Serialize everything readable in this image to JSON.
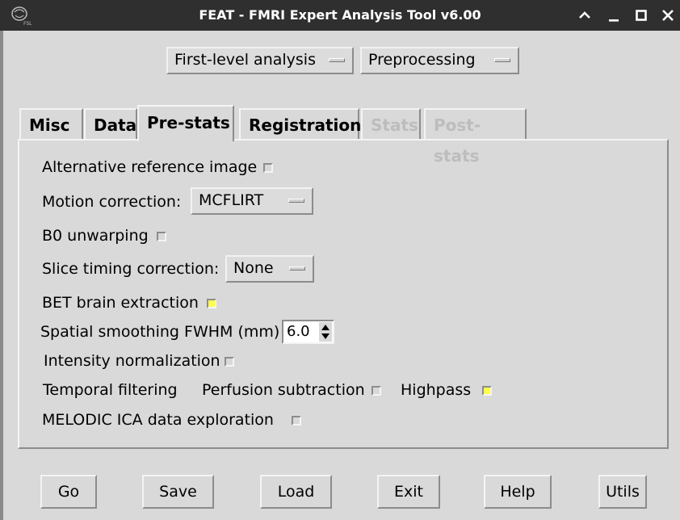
{
  "window": {
    "title": "FEAT - FMRI Expert Analysis Tool v6.00"
  },
  "top_selects": {
    "analysis_level": "First-level analysis",
    "analysis_stage": "Preprocessing"
  },
  "tabs": [
    {
      "label": "Misc",
      "state": "inactive"
    },
    {
      "label": "Data",
      "state": "inactive"
    },
    {
      "label": "Pre-stats",
      "state": "active"
    },
    {
      "label": "Registration",
      "state": "inactive"
    },
    {
      "label": "Stats",
      "state": "disabled"
    },
    {
      "label": "Post-stats",
      "state": "disabled"
    }
  ],
  "prestats": {
    "alt_reference": {
      "label": "Alternative reference image",
      "checked": false
    },
    "motion_correction": {
      "label": "Motion correction:",
      "value": "MCFLIRT"
    },
    "b0_unwarping": {
      "label": "B0 unwarping",
      "checked": false
    },
    "slice_timing": {
      "label": "Slice timing correction:",
      "value": "None"
    },
    "bet": {
      "label": "BET brain extraction",
      "checked": true
    },
    "smoothing": {
      "label": "Spatial smoothing FWHM (mm)",
      "value": "6.0"
    },
    "intensity_norm": {
      "label": "Intensity normalization",
      "checked": false
    },
    "temporal_filtering": {
      "label": "Temporal filtering"
    },
    "perfusion_subtraction": {
      "label": "Perfusion subtraction",
      "checked": false
    },
    "highpass": {
      "label": "Highpass",
      "checked": true
    },
    "melodic": {
      "label": "MELODIC ICA data exploration",
      "checked": false
    }
  },
  "colors": {
    "checked": "#ffff4d",
    "background": "#d9d9d9",
    "titlebar": "#2f2f2f"
  },
  "buttons": {
    "go": "Go",
    "save": "Save",
    "load": "Load",
    "exit": "Exit",
    "help": "Help",
    "utils": "Utils"
  }
}
